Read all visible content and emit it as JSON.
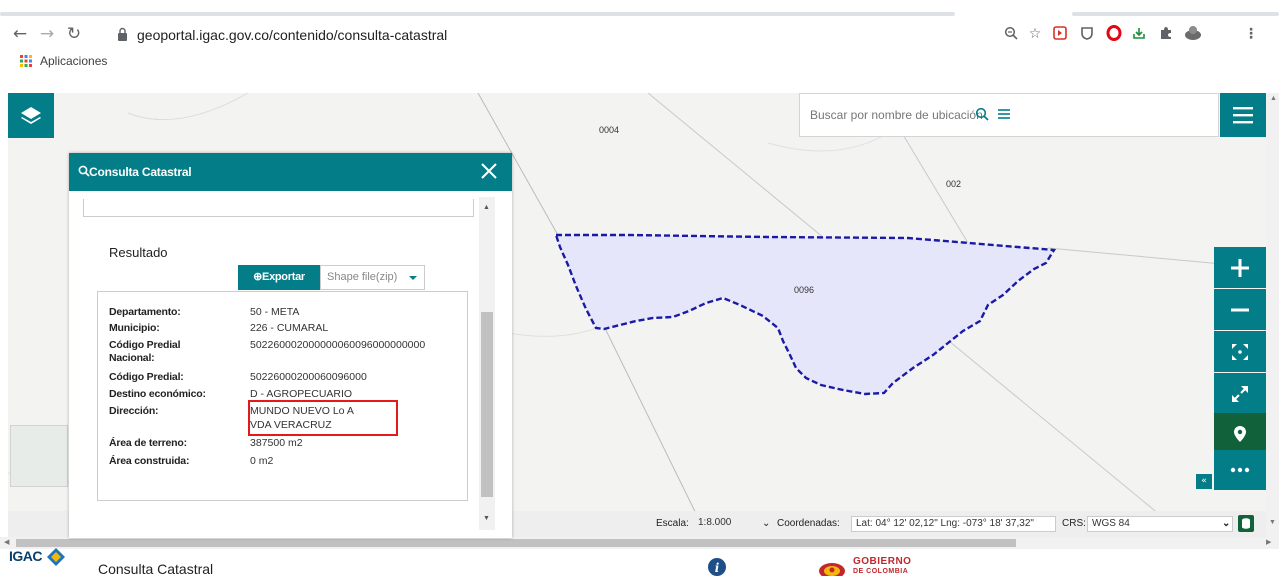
{
  "browser": {
    "url": "geoportal.igac.gov.co/contenido/consulta-catastral",
    "bookmarks_label": "Aplicaciones"
  },
  "map": {
    "search_placeholder": "Buscar por nombre de ubicación",
    "labels": {
      "parcel_0004": "0004",
      "parcel_002": "002",
      "parcel_0096": "0096"
    },
    "parcel_fill": "#e6e6fb",
    "parcel_stroke": "#1a1aa6"
  },
  "panel": {
    "title": "Consulta Catastral",
    "result_heading": "Resultado",
    "export_label": "⊕Exportar",
    "format_value": "Shape file(zip)",
    "fields": [
      {
        "label": "Departamento:",
        "value": "50 - META"
      },
      {
        "label": "Municipio:",
        "value": "226 - CUMARAL"
      },
      {
        "label": "Código Predial",
        "label2": "Nacional:",
        "value": "502260002000000060096000000000"
      },
      {
        "label": "Código Predial:",
        "value": "50226000200060096000"
      },
      {
        "label": "Destino económico:",
        "value": "D - AGROPECUARIO"
      },
      {
        "label": "Dirección:",
        "value": "MUNDO NUEVO Lo A",
        "value2": "VDA VERACRUZ"
      },
      {
        "label": "Área de terreno:",
        "value": "387500 m2"
      },
      {
        "label": "Área construida:",
        "value": "0 m2"
      }
    ]
  },
  "statusbar": {
    "scale_label": "Escala:",
    "scale_value": "1:8.000",
    "coords_label": "Coordenadas:",
    "coords_value": "Lat: 04° 12' 02,12\" Lng: -073° 18' 37,32\"",
    "crs_label": "CRS:",
    "crs_value": "WGS 84"
  },
  "footer": {
    "logo_text": "IGAC",
    "title": "Consulta Catastral",
    "gov_line1": "GOBIERNO",
    "gov_line2": "DE COLOMBIA"
  },
  "colors": {
    "brand": "#037e89",
    "location_tool": "#11613a",
    "highlight": "#e21a1a"
  }
}
